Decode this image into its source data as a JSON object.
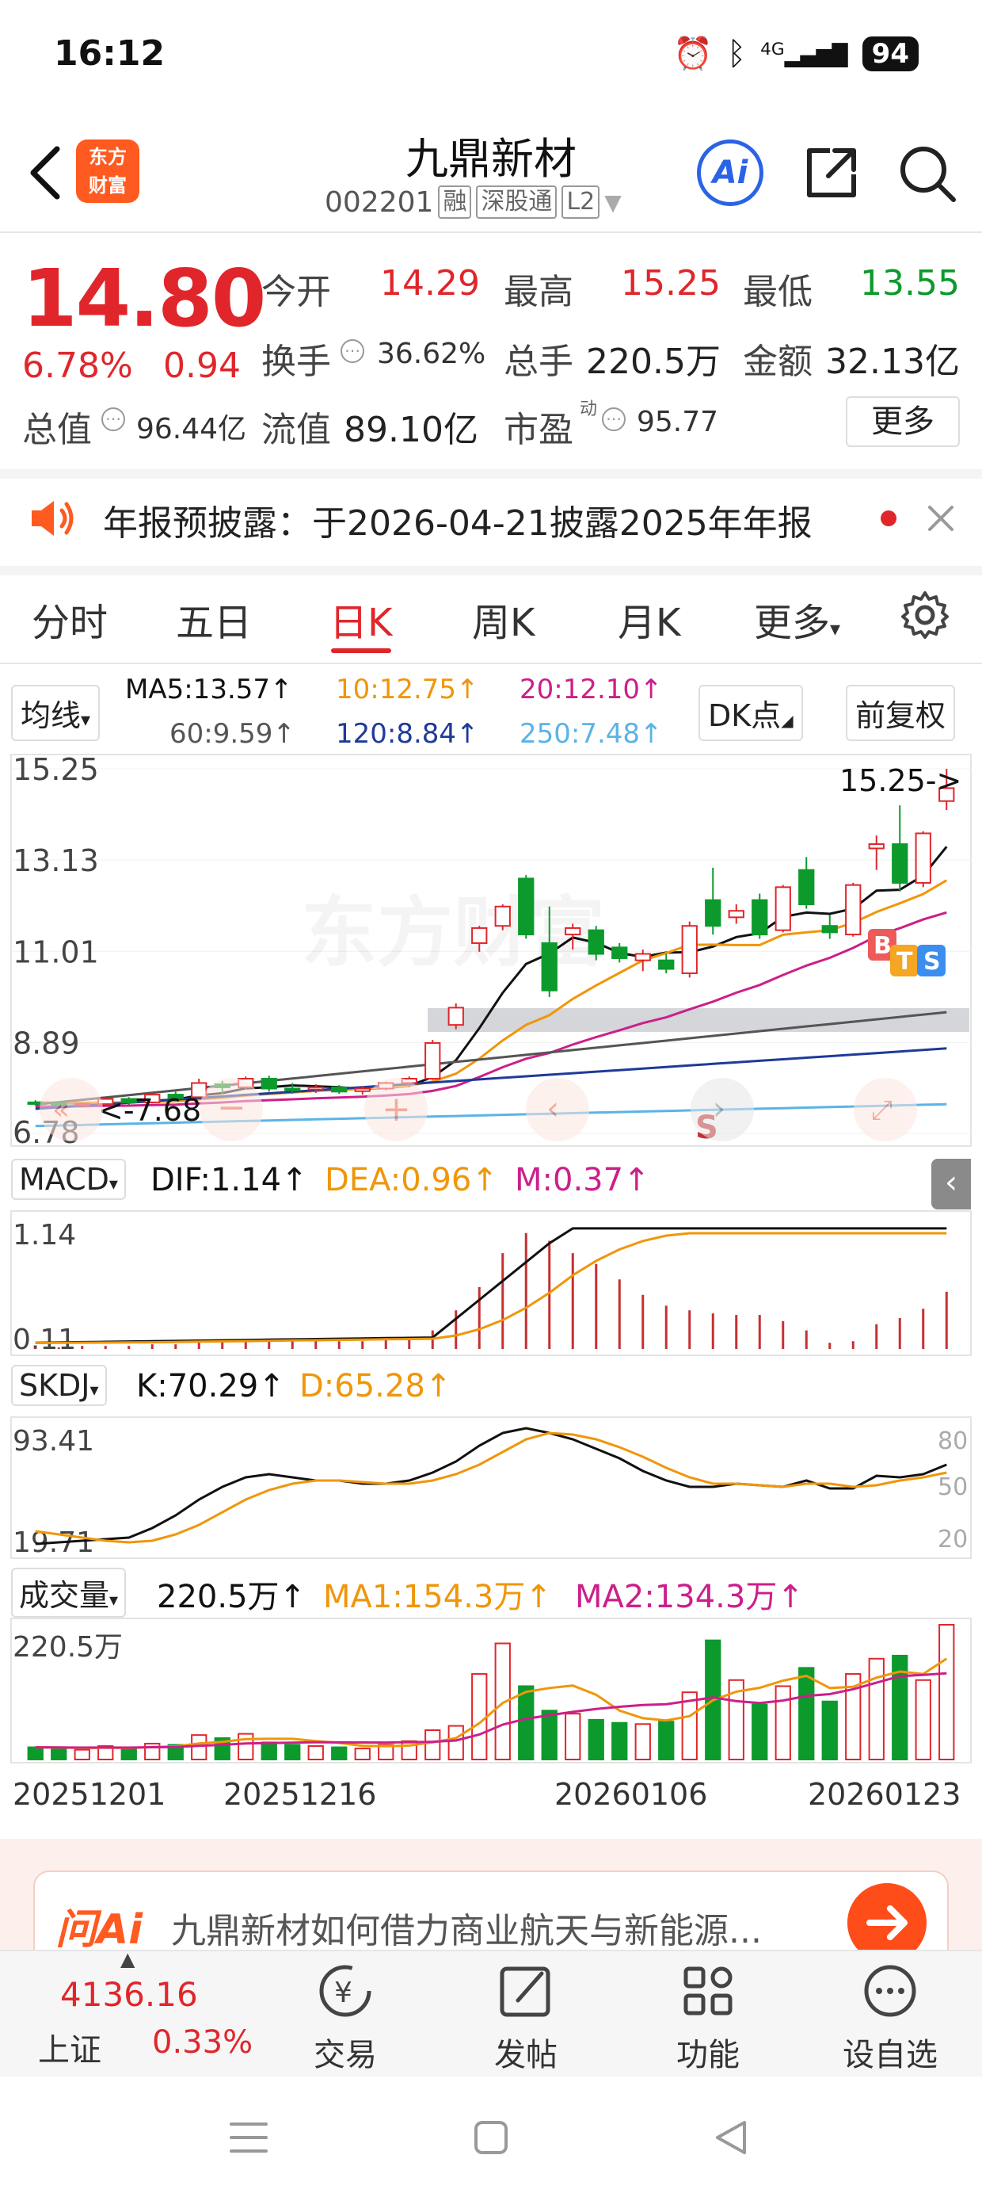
{
  "status": {
    "time": "16:12",
    "network": "4G",
    "battery": "94"
  },
  "header": {
    "logo_line1": "东方",
    "logo_line2": "财富",
    "name": "九鼎新材",
    "code": "002201",
    "tags": [
      "融",
      "深股通",
      "L2"
    ],
    "ai_label": "Ai"
  },
  "quote": {
    "price": "14.80",
    "change_pct": "6.78%",
    "change_val": "0.94",
    "open_label": "今开",
    "open": "14.29",
    "high_label": "最高",
    "high": "15.25",
    "low_label": "最低",
    "low": "13.55",
    "turnover_label": "换手",
    "turnover": "36.62%",
    "volume_label": "总手",
    "volume": "220.5万",
    "amount_label": "金额",
    "amount": "32.13亿",
    "mktcap_label": "总值",
    "mktcap": "96.44亿",
    "float_label": "流值",
    "float": "89.10亿",
    "pe_label": "市盈",
    "pe_sup": "动",
    "pe": "95.77",
    "more": "更多"
  },
  "notice": {
    "text": "年报预披露：于2026-04-21披露2025年年报"
  },
  "tabs": [
    "分时",
    "五日",
    "日K",
    "周K",
    "月K",
    "更多"
  ],
  "ma": {
    "selector": "均线",
    "ma5": "MA5:13.57↑",
    "ma10": "10:12.75↑",
    "ma20": "20:12.10↑",
    "ma60": "60:9.59↑",
    "ma120": "120:8.84↑",
    "ma250": "250:7.48↑",
    "dk": "DK点",
    "adjust": "前复权"
  },
  "kline": {
    "y_labels": [
      "15.25",
      "13.13",
      "11.01",
      "8.89",
      "6.78"
    ],
    "high_marker": "15.25->",
    "low_marker": "<-7.68",
    "watermark": "东方财富",
    "signals": [
      "B",
      "T",
      "S"
    ],
    "s_mark": "S"
  },
  "macd": {
    "selector": "MACD",
    "dif": "DIF:1.14↑",
    "dea": "DEA:0.96↑",
    "m": "M:0.37↑",
    "y_top": "1.14",
    "y_bottom": "0.11"
  },
  "skdj": {
    "selector": "SKDJ",
    "k": "K:70.29↑",
    "d": "D:65.28↑",
    "y_top": "93.41",
    "y_bottom": "19.71",
    "levels": [
      "80",
      "50",
      "20"
    ]
  },
  "vol": {
    "selector": "成交量",
    "value": "220.5万↑",
    "ma1": "MA1:154.3万↑",
    "ma2": "MA2:134.3万↑",
    "y_top": "220.5万"
  },
  "dates": [
    "20251201",
    "20251216",
    "20260106",
    "20260123"
  ],
  "ai": {
    "logo": "问Ai",
    "prompt": "九鼎新材如何借力商业航天与新能源..."
  },
  "index": {
    "value": "4136.16",
    "name": "上证",
    "pct": "0.33%"
  },
  "nav": [
    "交易",
    "发帖",
    "功能",
    "设自选"
  ],
  "colors": {
    "up": "#e0262b",
    "down": "#0c9a2c",
    "ma5": "#111111",
    "ma10": "#f0960a",
    "ma20": "#cc1f8a",
    "ma60": "#555555",
    "ma120": "#1f3a9a",
    "ma250": "#5ab4e6"
  },
  "chart_data": {
    "type": "candlestick",
    "ylim": [
      6.78,
      15.25
    ],
    "candles": [
      [
        7.5,
        7.55,
        7.42,
        7.48
      ],
      [
        7.48,
        7.52,
        7.4,
        7.45
      ],
      [
        7.44,
        7.5,
        7.38,
        7.47
      ],
      [
        7.46,
        7.6,
        7.42,
        7.58
      ],
      [
        7.58,
        7.62,
        7.45,
        7.5
      ],
      [
        7.5,
        7.72,
        7.48,
        7.68
      ],
      [
        7.68,
        7.75,
        7.55,
        7.6
      ],
      [
        7.62,
        8.05,
        7.6,
        7.95
      ],
      [
        7.92,
        8.0,
        7.7,
        7.85
      ],
      [
        7.85,
        8.1,
        7.8,
        8.05
      ],
      [
        8.05,
        8.12,
        7.75,
        7.82
      ],
      [
        7.82,
        7.95,
        7.7,
        7.8
      ],
      [
        7.8,
        7.92,
        7.72,
        7.85
      ],
      [
        7.85,
        7.9,
        7.7,
        7.75
      ],
      [
        7.76,
        7.88,
        7.68,
        7.82
      ],
      [
        7.82,
        7.98,
        7.78,
        7.95
      ],
      [
        7.95,
        8.1,
        7.85,
        8.05
      ],
      [
        8.05,
        8.95,
        8.02,
        8.88
      ],
      [
        9.3,
        9.8,
        9.2,
        9.7
      ],
      [
        11.2,
        11.6,
        11.0,
        11.55
      ],
      [
        11.6,
        12.1,
        11.5,
        12.05
      ],
      [
        12.7,
        12.78,
        11.3,
        11.4
      ],
      [
        11.2,
        12.05,
        9.95,
        10.1
      ],
      [
        11.4,
        11.65,
        11.05,
        11.55
      ],
      [
        11.5,
        11.6,
        10.8,
        10.95
      ],
      [
        11.1,
        11.2,
        10.75,
        10.85
      ],
      [
        10.8,
        11.05,
        10.55,
        10.95
      ],
      [
        10.8,
        10.95,
        10.5,
        10.6
      ],
      [
        10.5,
        11.7,
        10.4,
        11.6
      ],
      [
        12.2,
        12.95,
        11.4,
        11.6
      ],
      [
        11.8,
        12.1,
        11.65,
        11.95
      ],
      [
        12.2,
        12.35,
        11.3,
        11.4
      ],
      [
        11.5,
        12.55,
        11.45,
        12.5
      ],
      [
        12.9,
        13.2,
        12.0,
        12.1
      ],
      [
        11.6,
        11.85,
        11.3,
        11.45
      ],
      [
        11.4,
        12.6,
        11.35,
        12.55
      ],
      [
        13.4,
        13.7,
        12.9,
        13.5
      ],
      [
        13.5,
        14.4,
        12.4,
        12.6
      ],
      [
        12.6,
        13.8,
        12.5,
        13.75
      ],
      [
        14.5,
        15.25,
        14.29,
        14.8
      ]
    ],
    "volume": [
      20,
      18,
      16,
      22,
      19,
      26,
      24,
      40,
      35,
      42,
      28,
      24,
      22,
      20,
      18,
      24,
      30,
      48,
      55,
      140,
      190,
      120,
      80,
      75,
      65,
      60,
      58,
      62,
      110,
      195,
      130,
      90,
      120,
      150,
      95,
      140,
      165,
      170,
      130,
      220.5
    ],
    "macd_hist": [
      0.01,
      0.01,
      0.02,
      0.02,
      0.02,
      0.03,
      0.03,
      0.04,
      0.05,
      0.05,
      0.05,
      0.05,
      0.05,
      0.05,
      0.05,
      0.06,
      0.07,
      0.12,
      0.25,
      0.4,
      0.62,
      0.75,
      0.7,
      0.62,
      0.55,
      0.45,
      0.35,
      0.28,
      0.25,
      0.23,
      0.22,
      0.22,
      0.18,
      0.12,
      0.04,
      0.05,
      0.16,
      0.2,
      0.26,
      0.37
    ],
    "kdj_k": [
      20,
      21,
      22,
      23,
      24,
      30,
      38,
      48,
      56,
      62,
      64,
      62,
      60,
      60,
      58,
      58,
      60,
      65,
      72,
      82,
      90,
      93,
      90,
      86,
      80,
      74,
      66,
      60,
      56,
      56,
      58,
      57,
      56,
      60,
      55,
      55,
      63,
      62,
      64,
      70
    ],
    "kdj_d": [
      28,
      26,
      24,
      22,
      21,
      22,
      26,
      32,
      40,
      48,
      54,
      58,
      60,
      60,
      59,
      58,
      58,
      60,
      64,
      70,
      78,
      86,
      90,
      89,
      86,
      81,
      75,
      68,
      62,
      58,
      58,
      57,
      56,
      58,
      58,
      56,
      57,
      60,
      62,
      65
    ]
  }
}
